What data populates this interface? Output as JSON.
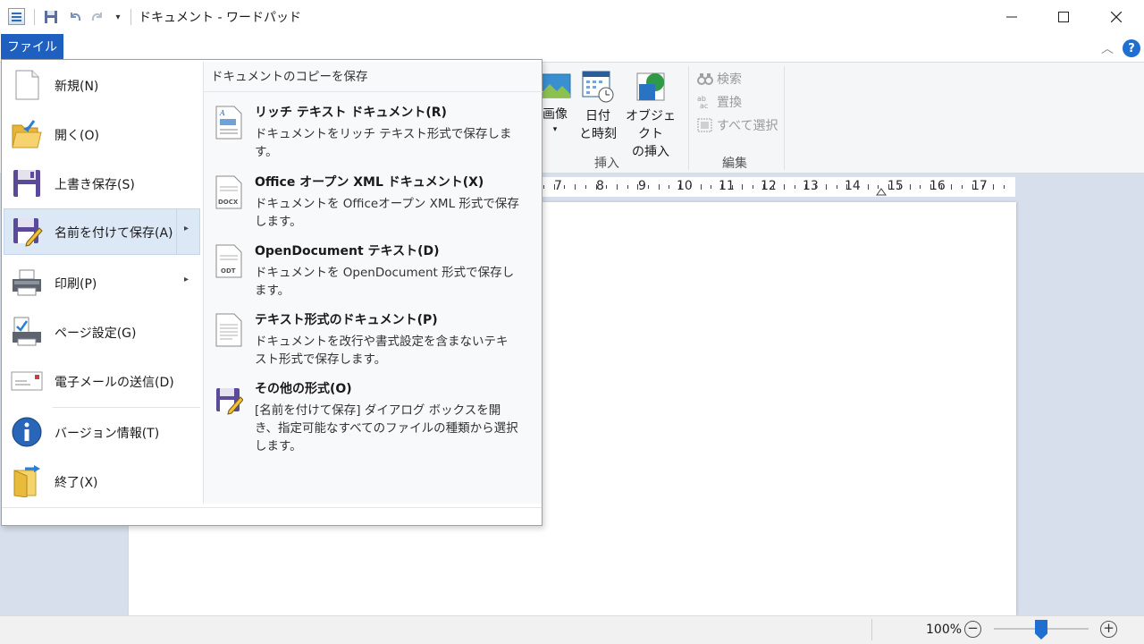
{
  "window": {
    "title": "ドキュメント - ワードパッド",
    "quick_access": [
      "save-icon",
      "undo-icon",
      "redo-icon",
      "customize-icon"
    ]
  },
  "ribbon": {
    "file_tab_label": "ファイル",
    "insert_group": {
      "label": "挿入",
      "image_button": "画像",
      "datetime_button_line1": "日付",
      "datetime_button_line2": "と時刻",
      "object_button_line1": "オブジェクト",
      "object_button_line2": "の挿入"
    },
    "edit_group": {
      "label": "編集",
      "find": "検索",
      "replace": "置換",
      "select_all": "すべて選択"
    }
  },
  "ruler": {
    "numbers": [
      "7",
      "8",
      "9",
      "10",
      "11",
      "12",
      "13",
      "14",
      "15",
      "16",
      "17"
    ]
  },
  "file_menu": {
    "items": [
      {
        "label": "新規(N)",
        "icon": "new-document-icon"
      },
      {
        "label": "開く(O)",
        "icon": "open-folder-icon"
      },
      {
        "label": "上書き保存(S)",
        "icon": "save-icon"
      },
      {
        "label": "名前を付けて保存(A)",
        "icon": "save-as-icon"
      },
      {
        "label": "印刷(P)",
        "icon": "printer-icon"
      },
      {
        "label": "ページ設定(G)",
        "icon": "page-setup-icon"
      },
      {
        "label": "電子メールの送信(D)",
        "icon": "email-icon"
      },
      {
        "label": "バージョン情報(T)",
        "icon": "info-icon"
      },
      {
        "label": "終了(X)",
        "icon": "exit-icon"
      }
    ],
    "panel": {
      "header": "ドキュメントのコピーを保存",
      "options": [
        {
          "title": "リッチ テキスト ドキュメント(R)",
          "desc": "ドキュメントをリッチ テキスト形式で保存します。",
          "icon": "rtf-document-icon"
        },
        {
          "title": "Office オープン XML ドキュメント(X)",
          "desc": "ドキュメントを Officeオープン XML 形式で保存します。",
          "icon": "docx-document-icon",
          "icon_label": "DOCX"
        },
        {
          "title": "OpenDocument テキスト(D)",
          "desc": "ドキュメントを OpenDocument 形式で保存します。",
          "icon": "odt-document-icon",
          "icon_label": "ODT"
        },
        {
          "title": "テキスト形式のドキュメント(P)",
          "desc": "ドキュメントを改行や書式設定を含まないテキスト形式で保存します。",
          "icon": "text-document-icon"
        },
        {
          "title": "その他の形式(O)",
          "desc": "[名前を付けて保存] ダイアログ ボックスを開き、指定可能なすべてのファイルの種類から選択します。",
          "icon": "other-formats-icon"
        }
      ]
    }
  },
  "statusbar": {
    "zoom": "100%",
    "zoom_out": "−",
    "zoom_in": "+",
    "zoom_fraction": 0.5
  },
  "colors": {
    "accent": "#1f5fbf",
    "selection": "#dde8f6",
    "doc_background": "#d7dfec"
  }
}
